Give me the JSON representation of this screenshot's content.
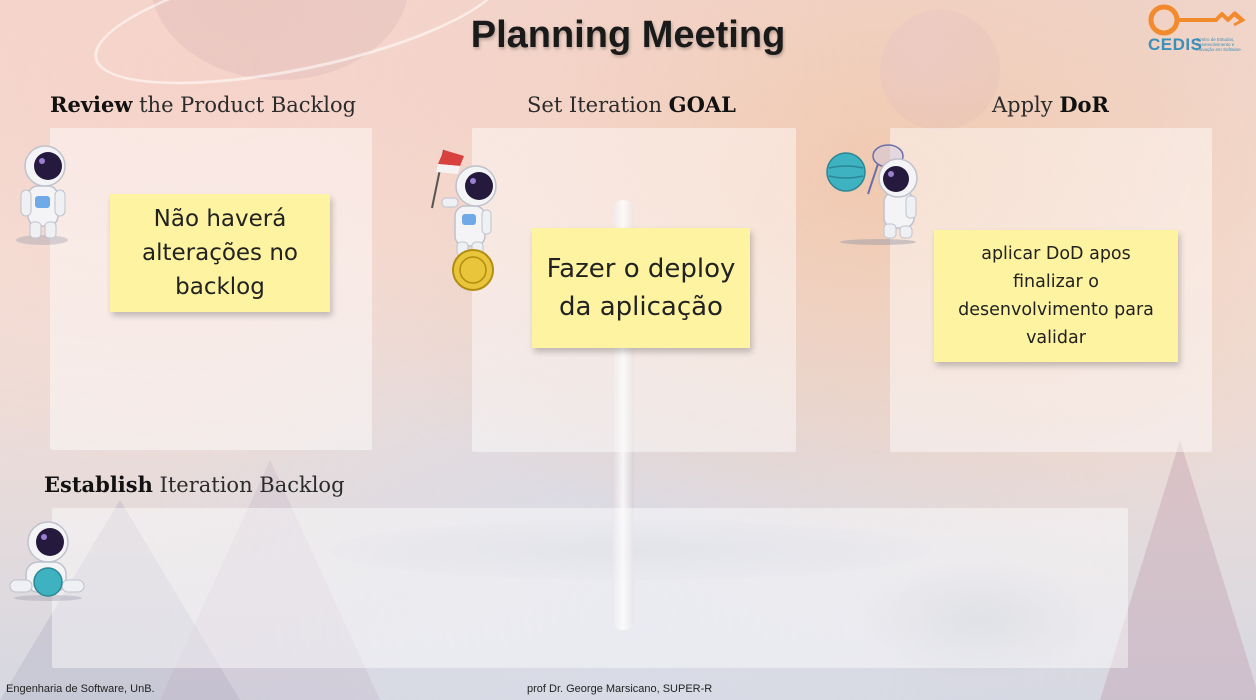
{
  "slide": {
    "title": "Planning Meeting"
  },
  "logo": {
    "name": "CEDIS",
    "subtitle": "Centro de Estudos, Desenvolvimento e Inovação em Software",
    "colors": {
      "icon": "#f28a2e",
      "text": "#3c8fb8"
    }
  },
  "sections": {
    "review": {
      "heading_bold": "Review",
      "heading_rest": " the Product Backlog",
      "note": "Não haverá alterações no backlog"
    },
    "goal": {
      "heading_rest": "Set Iteration ",
      "heading_bold": "GOAL",
      "note": "Fazer o deploy da aplicação"
    },
    "dor": {
      "heading_rest": "Apply ",
      "heading_bold": "DoR",
      "note": "aplicar DoD apos finalizar o desenvolvimento para validar"
    },
    "backlog": {
      "heading_bold": "Establish",
      "heading_rest": " Iteration Backlog"
    }
  },
  "footer": {
    "left": "Engenharia de Software, UnB.",
    "center": "prof Dr. George Marsicano, SUPER-R"
  },
  "colors": {
    "sticky_note": "#fdf3a0",
    "panel": "#ffffff"
  },
  "icons": [
    "astronaut-icon",
    "astronaut-flag-icon",
    "astronaut-net-icon",
    "astronaut-sitting-icon",
    "planet-icon",
    "medal-icon",
    "flag-icon"
  ]
}
